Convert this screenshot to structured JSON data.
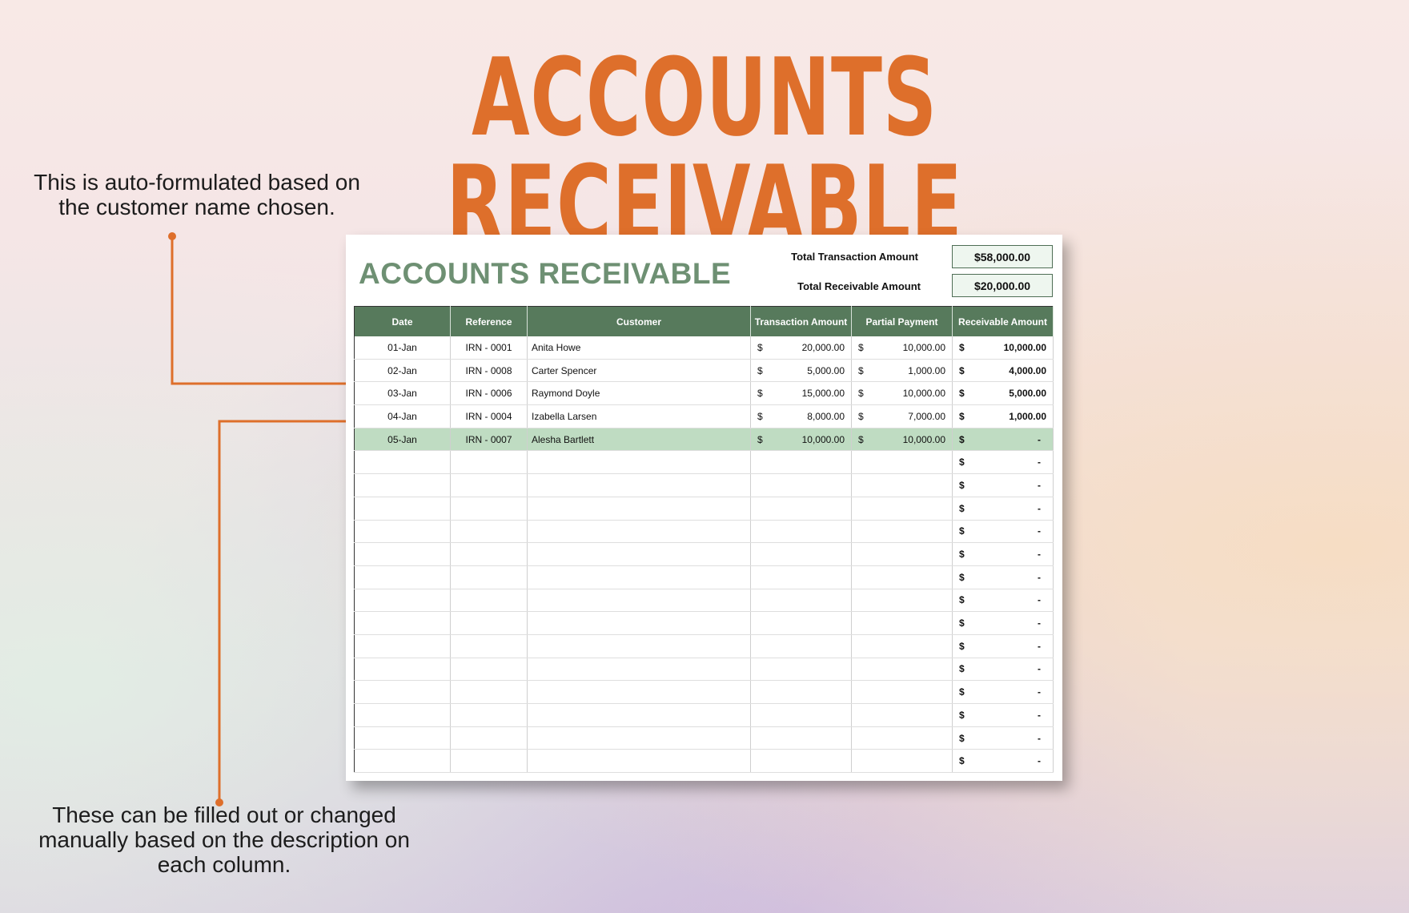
{
  "title": "ACCOUNTS RECEIVABLE",
  "notes": {
    "top": "This is auto-formulated based on the customer name chosen.",
    "bottom": "These can be filled out or changed manually based on the description on each column."
  },
  "colors": {
    "title": "#de6f2b",
    "arrow": "#de6f2b",
    "header_bg": "#577a5c",
    "sheet_title": "#6e9073",
    "highlight_row": "#bfdcc2"
  },
  "sheet": {
    "title": "ACCOUNTS RECEIVABLE",
    "summary": {
      "total_transaction_label": "Total Transaction Amount",
      "total_transaction_value": "$58,000.00",
      "total_receivable_label": "Total Receivable Amount",
      "total_receivable_value": "$20,000.00"
    },
    "columns": [
      "Date",
      "Reference",
      "Customer",
      "Transaction Amount",
      "Partial Payment",
      "Receivable Amount"
    ],
    "currency_symbol": "$",
    "empty_value": "-",
    "rows": [
      {
        "date": "01-Jan",
        "reference": "IRN - 0001",
        "customer": "Anita Howe",
        "transaction": "20,000.00",
        "partial": "10,000.00",
        "receivable": "10,000.00"
      },
      {
        "date": "02-Jan",
        "reference": "IRN - 0008",
        "customer": "Carter Spencer",
        "transaction": "5,000.00",
        "partial": "1,000.00",
        "receivable": "4,000.00"
      },
      {
        "date": "03-Jan",
        "reference": "IRN - 0006",
        "customer": "Raymond Doyle",
        "transaction": "15,000.00",
        "partial": "10,000.00",
        "receivable": "5,000.00"
      },
      {
        "date": "04-Jan",
        "reference": "IRN - 0004",
        "customer": "Izabella Larsen",
        "transaction": "8,000.00",
        "partial": "7,000.00",
        "receivable": "1,000.00"
      },
      {
        "date": "05-Jan",
        "reference": "IRN - 0007",
        "customer": "Alesha Bartlett",
        "transaction": "10,000.00",
        "partial": "10,000.00",
        "receivable": "-"
      }
    ],
    "highlighted_row": 4,
    "empty_rows": 14
  }
}
